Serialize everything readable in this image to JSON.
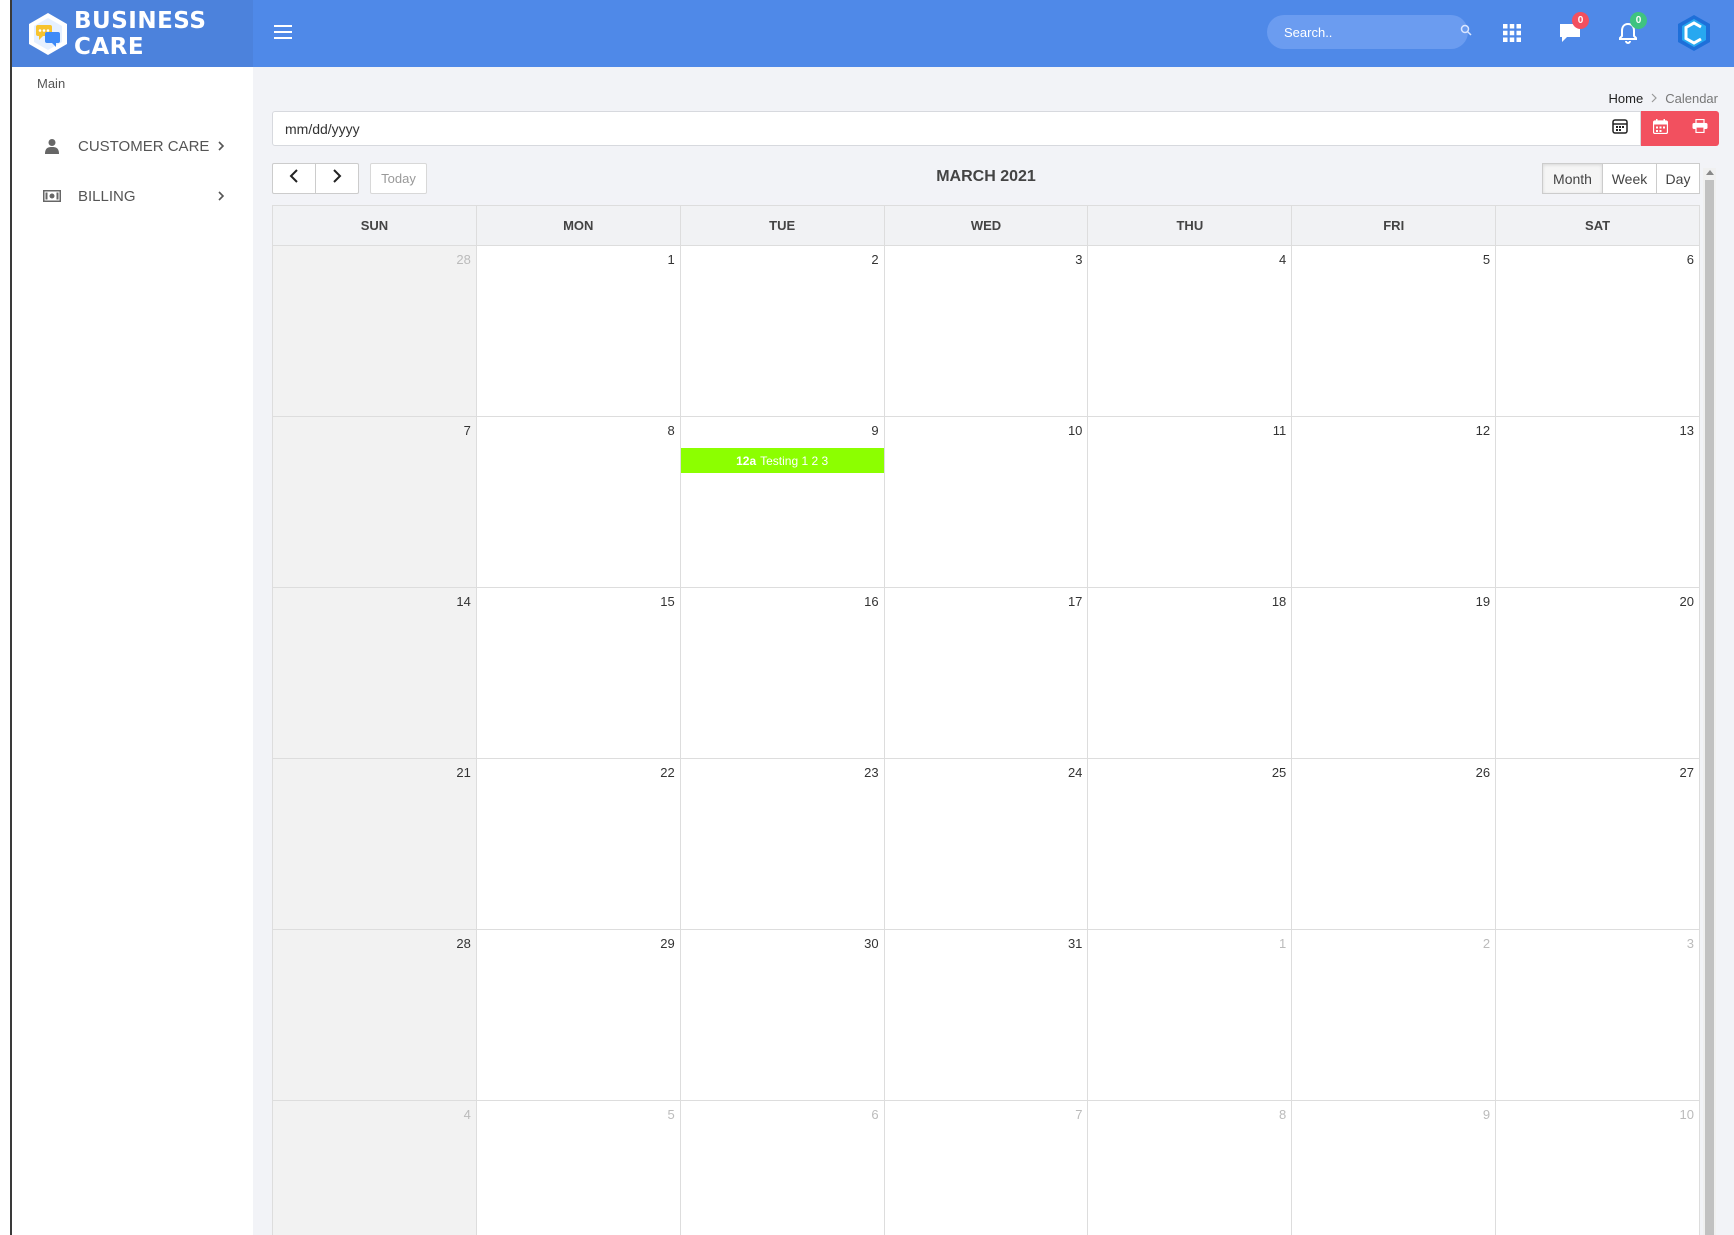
{
  "brand": {
    "name": "BUSINESS CARE"
  },
  "header": {
    "search_placeholder": "Search..",
    "messages_count": "0",
    "notifications_count": "0",
    "colors": {
      "bar": "#4f89e8",
      "badge_red": "#f2505f",
      "badge_green": "#3fc380"
    }
  },
  "sidebar": {
    "section": "Main",
    "items": [
      {
        "label": "CUSTOMER CARE",
        "icon": "user-icon"
      },
      {
        "label": "BILLING",
        "icon": "money-icon"
      }
    ]
  },
  "breadcrumb": {
    "home": "Home",
    "current": "Calendar"
  },
  "date_filter": {
    "placeholder": "mm/dd/yyyy"
  },
  "calendar": {
    "title": "MARCH 2021",
    "today_label": "Today",
    "views": [
      "Month",
      "Week",
      "Day"
    ],
    "active_view": "Month",
    "weekdays": [
      "SUN",
      "MON",
      "TUE",
      "WED",
      "THU",
      "FRI",
      "SAT"
    ],
    "weeks": [
      [
        {
          "d": "28",
          "o": true
        },
        {
          "d": "1"
        },
        {
          "d": "2"
        },
        {
          "d": "3"
        },
        {
          "d": "4"
        },
        {
          "d": "5"
        },
        {
          "d": "6"
        }
      ],
      [
        {
          "d": "7"
        },
        {
          "d": "8"
        },
        {
          "d": "9",
          "event": {
            "time": "12a",
            "title": "Testing 1 2 3"
          }
        },
        {
          "d": "10"
        },
        {
          "d": "11"
        },
        {
          "d": "12"
        },
        {
          "d": "13"
        }
      ],
      [
        {
          "d": "14"
        },
        {
          "d": "15"
        },
        {
          "d": "16"
        },
        {
          "d": "17"
        },
        {
          "d": "18"
        },
        {
          "d": "19"
        },
        {
          "d": "20"
        }
      ],
      [
        {
          "d": "21"
        },
        {
          "d": "22"
        },
        {
          "d": "23"
        },
        {
          "d": "24"
        },
        {
          "d": "25"
        },
        {
          "d": "26"
        },
        {
          "d": "27"
        }
      ],
      [
        {
          "d": "28"
        },
        {
          "d": "29"
        },
        {
          "d": "30"
        },
        {
          "d": "31"
        },
        {
          "d": "1",
          "o": true
        },
        {
          "d": "2",
          "o": true
        },
        {
          "d": "3",
          "o": true
        }
      ],
      [
        {
          "d": "4",
          "o": true
        },
        {
          "d": "5",
          "o": true
        },
        {
          "d": "6",
          "o": true
        },
        {
          "d": "7",
          "o": true
        },
        {
          "d": "8",
          "o": true
        },
        {
          "d": "9",
          "o": true
        },
        {
          "d": "10",
          "o": true
        }
      ]
    ],
    "event_color": "#8cff00"
  }
}
